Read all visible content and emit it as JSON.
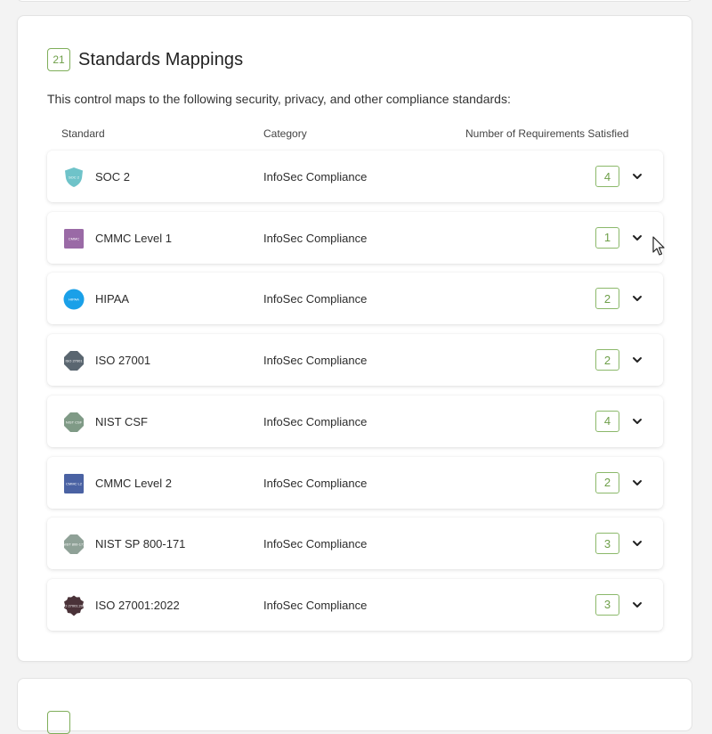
{
  "section": {
    "badge": "21",
    "title": "Standards Mappings",
    "description": "This control maps to the following security, privacy, and other compliance standards:"
  },
  "columns": {
    "standard": "Standard",
    "category": "Category",
    "requirements": "Number of Requirements Satisfied"
  },
  "standards": [
    {
      "name": "SOC 2",
      "category": "InfoSec Compliance",
      "count": "4",
      "logo_text": "SOC 2",
      "icon": "soc2-shield-icon",
      "color": "#6fc3c9"
    },
    {
      "name": "CMMC Level 1",
      "category": "InfoSec Compliance",
      "count": "1",
      "logo_text": "CMMC",
      "icon": "cmmc-level1-icon",
      "color": "#9a6aa6"
    },
    {
      "name": "HIPAA",
      "category": "InfoSec Compliance",
      "count": "2",
      "logo_text": "HIPAA",
      "icon": "hipaa-icon",
      "color": "#1aa0e8"
    },
    {
      "name": "ISO 27001",
      "category": "InfoSec Compliance",
      "count": "2",
      "logo_text": "ISO 27001",
      "icon": "iso27001-icon",
      "color": "#5a6670"
    },
    {
      "name": "NIST CSF",
      "category": "InfoSec Compliance",
      "count": "4",
      "logo_text": "NIST CSF",
      "icon": "nist-csf-icon",
      "color": "#7f9a86"
    },
    {
      "name": "CMMC Level 2",
      "category": "InfoSec Compliance",
      "count": "2",
      "logo_text": "CMMC L2",
      "icon": "cmmc-level2-icon",
      "color": "#4a62a3"
    },
    {
      "name": "NIST SP 800-171",
      "category": "InfoSec Compliance",
      "count": "3",
      "logo_text": "NIST 800-171",
      "icon": "nist-800-171-icon",
      "color": "#8fa197"
    },
    {
      "name": "ISO 27001:2022",
      "category": "InfoSec Compliance",
      "count": "3",
      "logo_text": "ISO 27001:2022",
      "icon": "iso27001-2022-icon",
      "color": "#4a3238"
    }
  ]
}
